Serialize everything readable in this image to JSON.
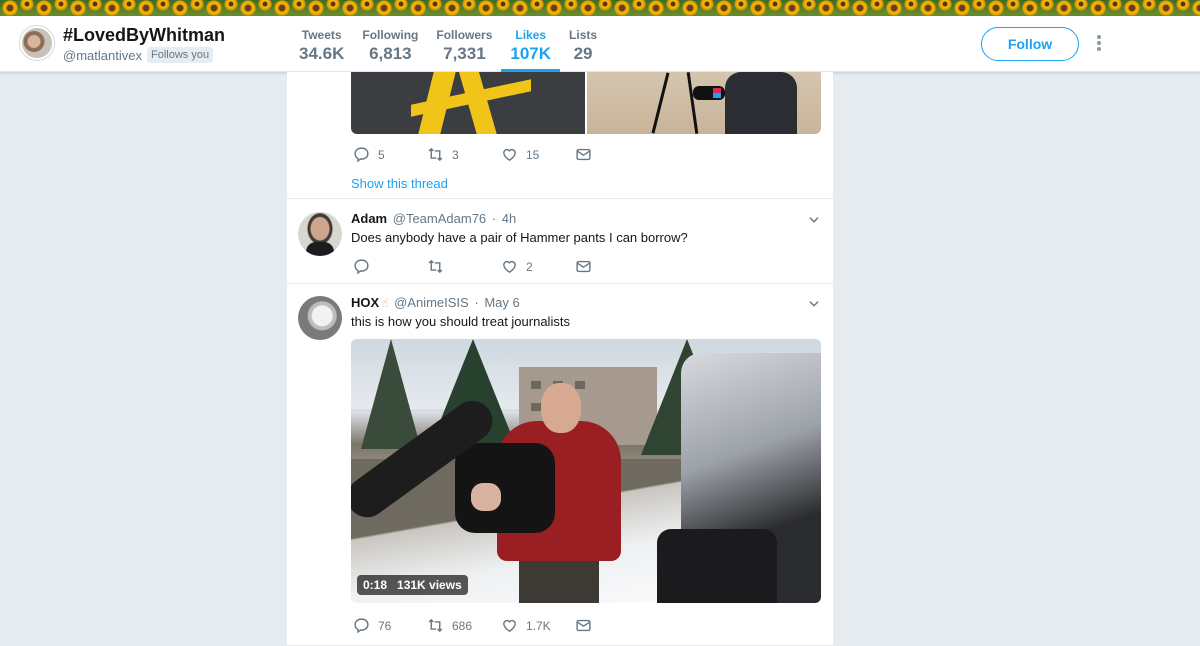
{
  "profile": {
    "name": "#LovedByWhitman",
    "handle": "@matlantivex",
    "follows_you": "Follows you",
    "follow_label": "Follow"
  },
  "stats": [
    {
      "label": "Tweets",
      "value": "34.6K"
    },
    {
      "label": "Following",
      "value": "6,813"
    },
    {
      "label": "Followers",
      "value": "7,331"
    },
    {
      "label": "Likes",
      "value": "107K",
      "active": true
    },
    {
      "label": "Lists",
      "value": "29"
    }
  ],
  "colors": {
    "accent": "#1da1f2",
    "muted": "#657786",
    "background": "#e6ecf0"
  },
  "tweets": [
    {
      "media": "two-photo-grid",
      "replies": "5",
      "retweets": "3",
      "likes": "15",
      "show_thread": "Show this thread"
    },
    {
      "name": "Adam",
      "handle": "@TeamAdam76",
      "time": "4h",
      "text": "Does anybody have a pair of Hammer pants I can borrow?",
      "replies": "",
      "retweets": "",
      "likes": "2"
    },
    {
      "name": "HOX",
      "emoji": "☝",
      "handle": "@AnimeISIS",
      "time": "May 6",
      "text": "this is how you should treat journalists",
      "video_duration": "0:18",
      "video_views": "131K views",
      "replies": "76",
      "retweets": "686",
      "likes": "1.7K"
    }
  ],
  "icons": {
    "reply": "reply-icon",
    "retweet": "retweet-icon",
    "like": "heart-icon",
    "dm": "envelope-icon",
    "caret": "chevron-down-icon",
    "more": "more-vertical-icon"
  }
}
